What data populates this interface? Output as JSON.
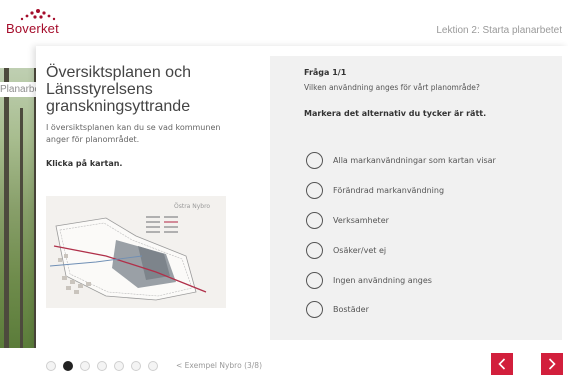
{
  "header": {
    "logo_text": "Boverket",
    "lesson": "Lektion 2: Starta planarbetet"
  },
  "background_label": "Planarbetet",
  "content": {
    "title": "Översiktsplanen och Länsstyrelsens granskningsyttrande",
    "lead": "I översiktsplanen kan du se vad kommunen anger för planområdet.",
    "hint": "Klicka på kartan.",
    "map_label": "Östra Nybro"
  },
  "question": {
    "number": "Fråga 1/1",
    "text": "Vilken användning anges för vårt planområde?",
    "instruction": "Markera det alternativ du tycker är rätt.",
    "options": [
      "Alla markanvändningar som kartan visar",
      "Förändrad markanvändning",
      "Verksamheter",
      "Osäker/vet ej",
      "Ingen användning anges",
      "Bostäder"
    ]
  },
  "footer": {
    "progress": "< Exempel Nybro (3/8)",
    "dots_total": 7,
    "dot_active_index": 1
  },
  "colors": {
    "brand": "#a50d2b",
    "nav_button": "#d21f3c"
  }
}
